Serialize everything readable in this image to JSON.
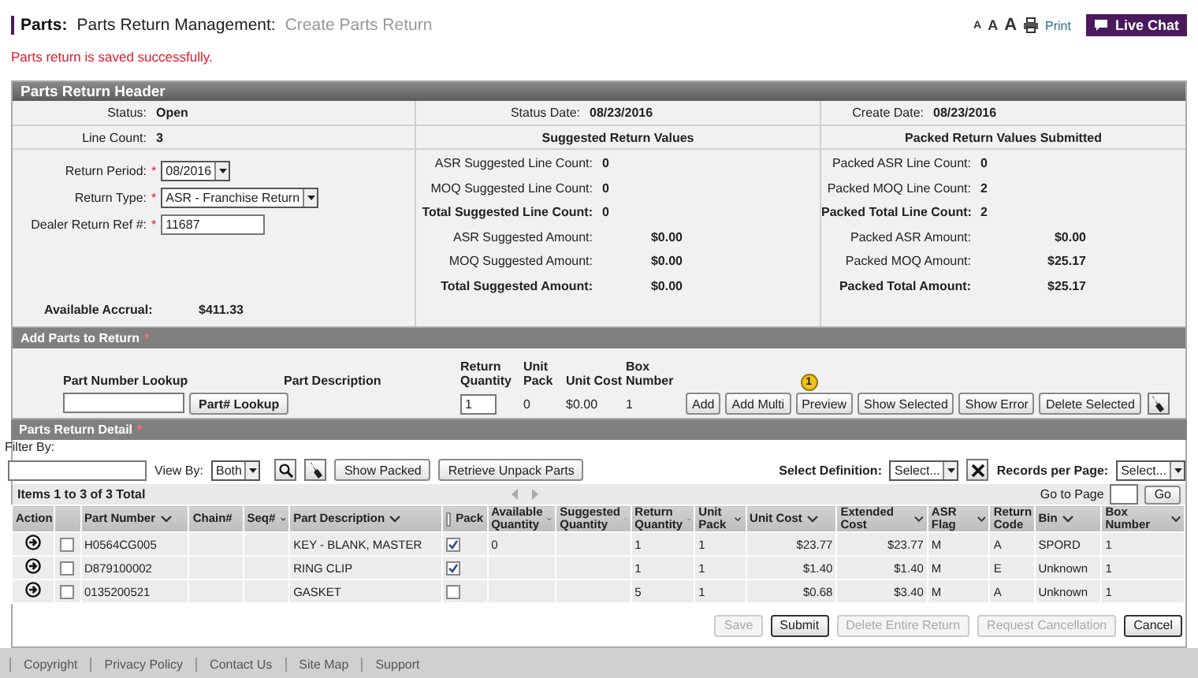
{
  "header": {
    "section": "Parts:",
    "module": "Parts Return Management:",
    "page": "Create Parts Return",
    "text_sizes": [
      "A",
      "A",
      "A"
    ],
    "print": "Print",
    "live_chat": "Live Chat"
  },
  "message": "Parts return is saved successfully.",
  "return_header": {
    "title": "Parts Return Header",
    "status": {
      "label": "Status:",
      "value": "Open"
    },
    "status_date": {
      "label": "Status Date:",
      "value": "08/23/2016"
    },
    "create_date": {
      "label": "Create Date:",
      "value": "08/23/2016"
    },
    "line_count": {
      "label": "Line Count:",
      "value": "3"
    },
    "fields": [
      {
        "kind": "select",
        "label": "Return Period:",
        "required_marker": "*",
        "value": "08/2016"
      },
      {
        "kind": "select",
        "label": "Return Type:",
        "required_marker": "*",
        "value": "ASR - Franchise Return"
      },
      {
        "kind": "input",
        "label": "Dealer Return Ref #:",
        "required_marker": "*",
        "value": "11687"
      }
    ],
    "accrual": {
      "label": "Available Accrual:",
      "value": "$411.33"
    },
    "suggested": {
      "heading": "Suggested Return Values",
      "items": [
        {
          "kind": "count",
          "total": false,
          "label": "ASR Suggested Line Count:",
          "value": "0"
        },
        {
          "kind": "count",
          "total": false,
          "label": "MOQ Suggested Line Count:",
          "value": "0"
        },
        {
          "kind": "count",
          "total": true,
          "label": "Total Suggested Line Count:",
          "value": "0"
        },
        {
          "kind": "amount",
          "total": false,
          "label": "ASR Suggested Amount:",
          "value": "$0.00"
        },
        {
          "kind": "amount",
          "total": false,
          "label": "MOQ Suggested Amount:",
          "value": "$0.00"
        },
        {
          "kind": "amount",
          "total": true,
          "label": "Total Suggested Amount:",
          "value": "$0.00"
        }
      ]
    },
    "packed": {
      "heading": "Packed Return Values Submitted",
      "items": [
        {
          "kind": "count",
          "total": false,
          "label": "Packed ASR Line Count:",
          "value": "0"
        },
        {
          "kind": "count",
          "total": false,
          "label": "Packed MOQ Line Count:",
          "value": "2"
        },
        {
          "kind": "count",
          "total": true,
          "label": "Packed Total Line Count:",
          "value": "2"
        },
        {
          "kind": "amount",
          "total": false,
          "label": "Packed ASR Amount:",
          "value": "$0.00"
        },
        {
          "kind": "amount",
          "total": false,
          "label": "Packed MOQ Amount:",
          "value": "$25.17"
        },
        {
          "kind": "amount",
          "total": true,
          "label": "Packed Total Amount:",
          "value": "$25.17"
        }
      ]
    }
  },
  "add_parts": {
    "title": "Add Parts to Return",
    "required_marker": "*",
    "columns": [
      "Part Number Lookup",
      "Part Description",
      "Return Quantity",
      "Unit Pack",
      "Unit Cost",
      "Box Number"
    ],
    "lookup_button": "Part# Lookup",
    "quantity": "1",
    "unit_pack": "0",
    "unit_cost": "$0.00",
    "box_number": "1",
    "buttons": [
      {
        "label": "Add"
      },
      {
        "label": "Add Multi"
      },
      {
        "label": "Preview",
        "badge": "1"
      },
      {
        "label": "Show Selected"
      },
      {
        "label": "Show Error"
      },
      {
        "label": "Delete Selected"
      }
    ]
  },
  "detail": {
    "title": "Parts Return Detail",
    "required_marker": "*",
    "filter_label": "Filter By:",
    "view_by_label": "View By:",
    "view_by": "Both",
    "buttons": [
      "Show Packed",
      "Retrieve Unpack Parts"
    ],
    "definition_label": "Select Definition:",
    "definition": "Select...",
    "records_label": "Records per Page:",
    "records": "Select...",
    "items": "Items 1 to 3 of 3 Total",
    "go_to_page": "Go to Page",
    "go": "Go",
    "table": {
      "columns": [
        {
          "label": "Action",
          "sortable": false
        },
        {
          "label": "Part Number",
          "sortable": true
        },
        {
          "label": "Chain#",
          "sortable": false
        },
        {
          "label": "Seq#",
          "sortable": true
        },
        {
          "label": "Part Description",
          "sortable": true
        },
        {
          "label": "Pack",
          "sortable": false,
          "checked": false
        },
        {
          "label": "Available Quantity",
          "sortable": true
        },
        {
          "label": "Suggested Quantity",
          "sortable": true
        },
        {
          "label": "Return Quantity",
          "sortable": true
        },
        {
          "label": "Unit Pack",
          "sortable": true
        },
        {
          "label": "Unit Cost",
          "sortable": true
        },
        {
          "label": "Extended Cost",
          "sortable": true
        },
        {
          "label": "ASR Flag",
          "sortable": true
        },
        {
          "label": "Return Code",
          "sortable": false
        },
        {
          "label": "Bin",
          "sortable": true
        },
        {
          "label": "Box Number",
          "sortable": true
        }
      ],
      "rows": [
        {
          "selected": false,
          "part_number": "H0564CG005",
          "description": "KEY - BLANK, MASTER",
          "packed": true,
          "available_quantity": "0",
          "return_quantity": "1",
          "unit_pack": "1",
          "unit_cost": "$23.77",
          "extended_cost": "$23.77",
          "asr_flag": "M",
          "return_code": "A",
          "bin": "SPORD",
          "box_number": "1"
        },
        {
          "selected": false,
          "part_number": "D879100002",
          "description": "RING CLIP",
          "packed": true,
          "return_quantity": "1",
          "unit_pack": "1",
          "unit_cost": "$1.40",
          "extended_cost": "$1.40",
          "asr_flag": "M",
          "return_code": "E",
          "bin": "Unknown",
          "box_number": "1"
        },
        {
          "selected": false,
          "part_number": "0135200521",
          "description": "GASKET",
          "packed": false,
          "return_quantity": "5",
          "unit_pack": "1",
          "unit_cost": "$0.68",
          "extended_cost": "$3.40",
          "asr_flag": "M",
          "return_code": "A",
          "bin": "Unknown",
          "box_number": "1"
        }
      ]
    }
  },
  "actions": [
    {
      "label": "Save",
      "disabled": true
    },
    {
      "label": "Submit",
      "disabled": false
    },
    {
      "label": "Delete Entire Return",
      "disabled": true
    },
    {
      "label": "Request Cancellation",
      "disabled": true
    },
    {
      "label": "Cancel",
      "disabled": false
    }
  ],
  "footer": [
    "Copyright",
    "Privacy Policy",
    "Contact Us",
    "Site Map",
    "Support"
  ]
}
